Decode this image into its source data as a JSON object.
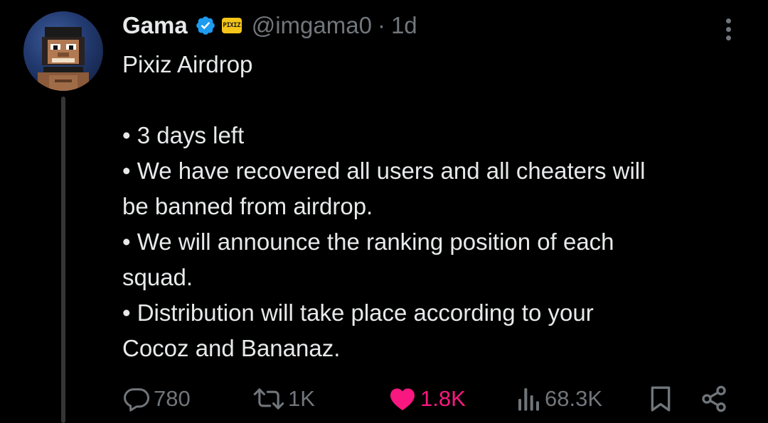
{
  "tweet": {
    "author": {
      "display_name": "Gama",
      "handle": "@imgama0",
      "affiliate_badge": "PIXIZ",
      "verified": true
    },
    "separator": "·",
    "time": "1d",
    "text_lines": [
      "Pixiz Airdrop",
      "",
      "• 3 days left",
      "• We have recovered all users and all cheaters will",
      "be banned from airdrop.",
      "• We will announce the ranking position of each",
      "squad.",
      "• Distribution will take place according to your",
      "Cocoz and Bananaz."
    ]
  },
  "actions": {
    "replies": "780",
    "reposts": "1K",
    "likes": "1.8K",
    "views": "68.3K"
  },
  "icons": {
    "more": "more-options-icon",
    "reply": "reply-icon",
    "repost": "repost-icon",
    "like": "heart-icon",
    "views": "views-chart-icon",
    "bookmark": "bookmark-icon",
    "share": "share-icon",
    "verified": "verified-badge-icon"
  },
  "colors": {
    "background": "#000000",
    "text": "#e7e9ea",
    "muted": "#71767b",
    "verified_blue": "#1d9bf0",
    "like_pink": "#f91880",
    "affiliate_yellow": "#f5c518"
  }
}
